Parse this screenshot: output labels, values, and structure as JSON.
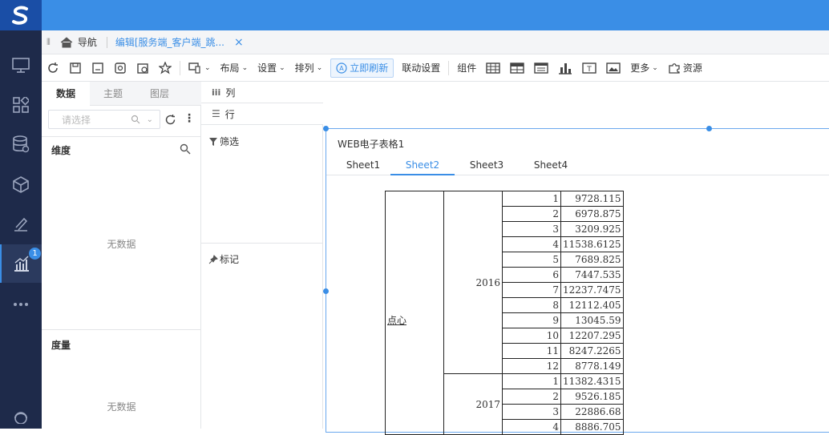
{
  "nav": {
    "badge": "1",
    "items": [
      "monitor-icon",
      "dashboard-icon",
      "database-icon",
      "cube-icon",
      "pen-icon",
      "chart-icon",
      "more-icon"
    ]
  },
  "tabbar": {
    "nav_label": "导航",
    "active_tab": "编辑[服务端_客户端_跳...",
    "close": "×"
  },
  "toolbar": {
    "layout": "布局",
    "settings": "设置",
    "arrange": "排列",
    "refresh_now": "立即刷新",
    "link_settings": "联动设置",
    "components": "组件",
    "more": "更多",
    "resources": "资源"
  },
  "panel": {
    "tabs": [
      "数据",
      "主题",
      "图层"
    ],
    "select_placeholder": "请选择",
    "dimension": "维度",
    "dim_empty": "无数据",
    "measure": "度量",
    "measure_empty": "无数据"
  },
  "config": {
    "columns": "列",
    "rows": "行",
    "filter": "筛选",
    "mark": "标记"
  },
  "widget": {
    "title": "WEB电子表格1",
    "sheets": [
      "Sheet1",
      "Sheet2",
      "Sheet3",
      "Sheet4"
    ],
    "active_sheet": 1,
    "category": "点心",
    "years": [
      {
        "year": "2016",
        "rows": [
          [
            "1",
            "9728.115"
          ],
          [
            "2",
            "6978.875"
          ],
          [
            "3",
            "3209.925"
          ],
          [
            "4",
            "11538.6125"
          ],
          [
            "5",
            "7689.825"
          ],
          [
            "6",
            "7447.535"
          ],
          [
            "7",
            "12237.7475"
          ],
          [
            "8",
            "12112.405"
          ],
          [
            "9",
            "13045.59"
          ],
          [
            "10",
            "12207.295"
          ],
          [
            "11",
            "8247.2265"
          ],
          [
            "12",
            "8778.149"
          ]
        ]
      },
      {
        "year": "2017",
        "rows": [
          [
            "1",
            "11382.4315"
          ],
          [
            "2",
            "9526.185"
          ],
          [
            "3",
            "22886.68"
          ],
          [
            "4",
            "8886.705"
          ]
        ]
      }
    ]
  }
}
